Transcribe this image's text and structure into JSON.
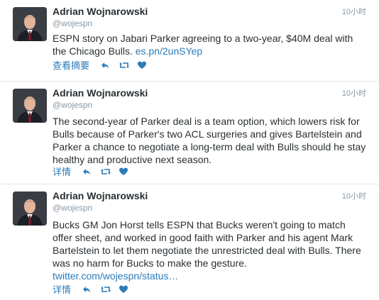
{
  "tweets": [
    {
      "name": "Adrian Wojnarowski",
      "handle": "@wojespn",
      "time": "10小时",
      "text": "ESPN story on Jabari Parker agreeing to a two-year, $40M deal with the Chicago Bulls.",
      "link": "es.pn/2unSYep",
      "expand_label": "查看摘要"
    },
    {
      "name": "Adrian Wojnarowski",
      "handle": "@wojespn",
      "time": "10小时",
      "text": "The second-year of Parker deal is a team option, which lowers risk for Bulls because of Parker's two ACL surgeries and gives Bartelstein and Parker a chance to negotiate a long-term deal with Bulls should he stay healthy and productive next season.",
      "link": "",
      "expand_label": "详情"
    },
    {
      "name": "Adrian Wojnarowski",
      "handle": "@wojespn",
      "time": "10小时",
      "text": "Bucks GM Jon Horst tells ESPN that Bucks weren't going to match offer sheet, and worked in good faith with Parker and his agent Mark Bartelstein to let them negotiate the unrestricted deal with Bulls. There was no harm for Bucks to make the gesture.",
      "link": "twitter.com/wojespn/status…",
      "expand_label": "详情"
    }
  ],
  "icons": {
    "reply": "reply-icon",
    "retweet": "retweet-icon",
    "like": "heart-icon"
  },
  "colors": {
    "link": "#2b7bb9",
    "text": "#292f33",
    "muted": "#8899a6",
    "divider": "#e1e8ed"
  }
}
